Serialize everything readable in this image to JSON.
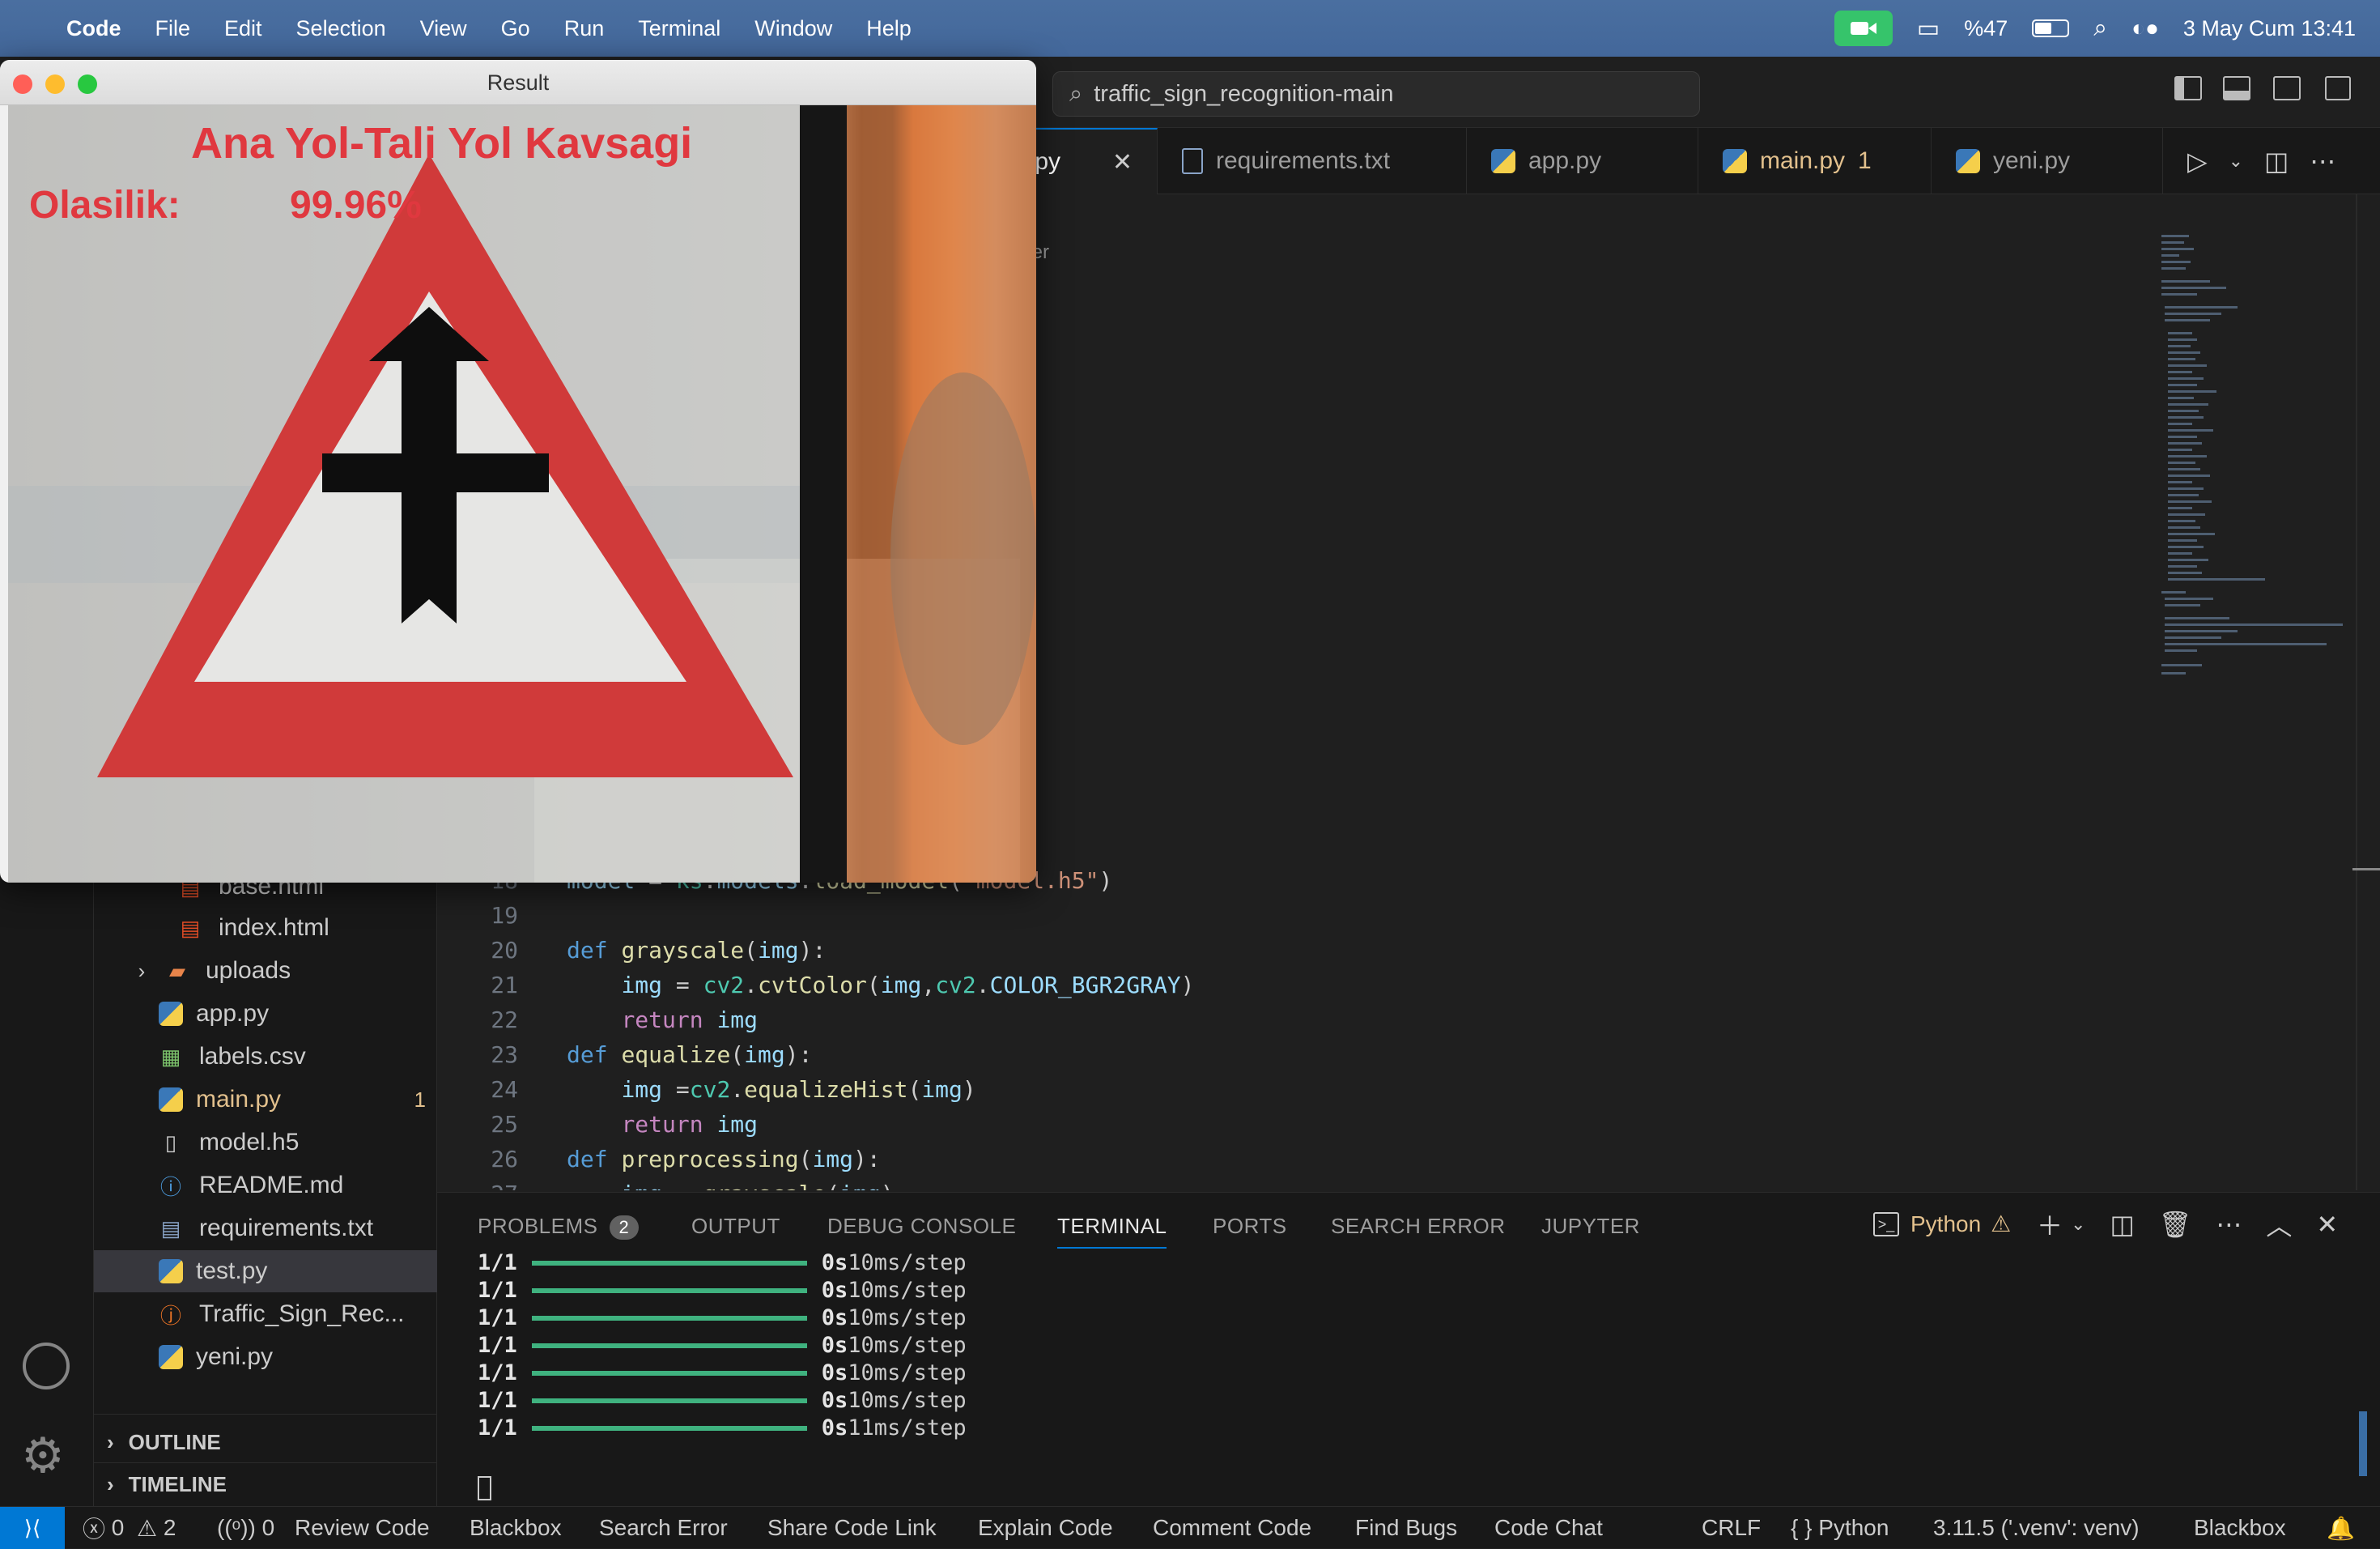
{
  "menubar": {
    "app": "Code",
    "items": [
      "File",
      "Edit",
      "Selection",
      "View",
      "Go",
      "Run",
      "Terminal",
      "Window",
      "Help"
    ],
    "battery": "%47",
    "datetime": "3 May Cum  13:41"
  },
  "search": {
    "text": "traffic_sign_recognition-main"
  },
  "tabs": [
    {
      "label": ".py",
      "active": true
    },
    {
      "label": "requirements.txt"
    },
    {
      "label": "app.py"
    },
    {
      "label": "main.py",
      "badge": "1"
    },
    {
      "label": "yeni.py"
    }
  ],
  "editor": {
    "breadcrumb_frag": "ter",
    "lines": [
      {
        "n": "18",
        "partial": "model = ks.models.load_model(\"model.h5\")"
      },
      {
        "n": "19"
      },
      {
        "n": "20"
      },
      {
        "n": "21"
      },
      {
        "n": "22"
      },
      {
        "n": "23"
      },
      {
        "n": "24"
      },
      {
        "n": "25"
      },
      {
        "n": "26"
      },
      {
        "n": "27"
      }
    ]
  },
  "explorer": {
    "items": [
      {
        "label": "base.html"
      },
      {
        "label": "index.html"
      },
      {
        "label": "uploads"
      },
      {
        "label": "app.py"
      },
      {
        "label": "labels.csv"
      },
      {
        "label": "main.py",
        "badge": "1"
      },
      {
        "label": "model.h5"
      },
      {
        "label": "README.md"
      },
      {
        "label": "requirements.txt"
      },
      {
        "label": "test.py"
      },
      {
        "label": "Traffic_Sign_Rec..."
      },
      {
        "label": "yeni.py"
      }
    ],
    "outline": "OUTLINE",
    "timeline": "TIMELINE"
  },
  "panel": {
    "tabs": [
      "PROBLEMS",
      "OUTPUT",
      "DEBUG CONSOLE",
      "TERMINAL",
      "PORTS",
      "SEARCH ERROR",
      "JUPYTER"
    ],
    "problems_count": "2",
    "shell": "Python",
    "terminal_lines": [
      {
        "step": "1/1",
        "time": "0s",
        "rate": "10ms/step"
      },
      {
        "step": "1/1",
        "time": "0s",
        "rate": "10ms/step"
      },
      {
        "step": "1/1",
        "time": "0s",
        "rate": "10ms/step"
      },
      {
        "step": "1/1",
        "time": "0s",
        "rate": "10ms/step"
      },
      {
        "step": "1/1",
        "time": "0s",
        "rate": "10ms/step"
      },
      {
        "step": "1/1",
        "time": "0s",
        "rate": "10ms/step"
      },
      {
        "step": "1/1",
        "time": "0s",
        "rate": "11ms/step"
      }
    ]
  },
  "status": {
    "errors": "0",
    "warnings": "2",
    "ports": "0",
    "items": [
      "Review Code",
      "Blackbox",
      "Search Error",
      "Share Code Link",
      "Explain Code",
      "Comment Code",
      "Find Bugs",
      "Code Chat"
    ],
    "eol": "CRLF",
    "language": "Python",
    "interpreter": "3.11.5 ('.venv': venv)",
    "blackbox": "Blackbox"
  },
  "result_window": {
    "title": "Result",
    "class_label": "Ana Yol-Tali Yol Kavsagi",
    "prob_label": "Olasilik:",
    "prob_value": "99.96%",
    "probability": 0.9996
  },
  "colors": {
    "accent": "#0078d4",
    "overlay_text": "#e0383f",
    "progress": "#3fb27f"
  }
}
